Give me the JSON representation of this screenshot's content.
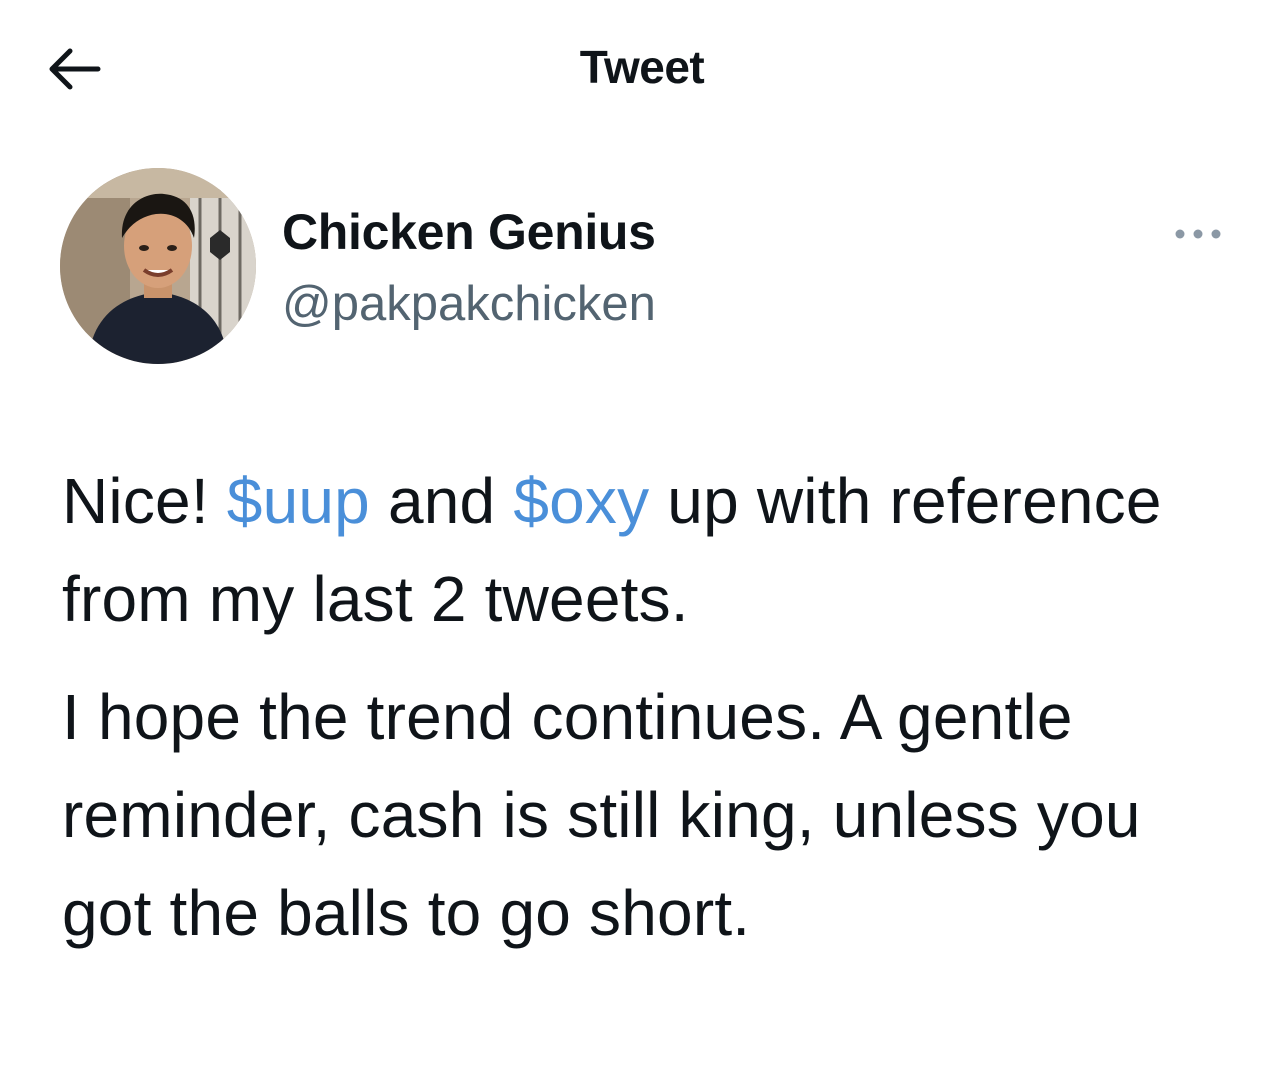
{
  "header": {
    "title": "Tweet",
    "back_icon": "arrow-left-icon"
  },
  "author": {
    "display_name": "Chicken Genius",
    "handle": "@pakpakchicken",
    "more_icon": "more-horizontal-icon"
  },
  "tweet": {
    "paragraph1": {
      "t1": "Nice! ",
      "cashtag1": "$uup",
      "t2": " and ",
      "cashtag2": "$oxy",
      "t3": " up with reference from my last 2 tweets."
    },
    "paragraph2": "I hope the trend continues. A gentle reminder, cash is still king, unless you got the balls to go short."
  },
  "colors": {
    "text": "#0f1419",
    "secondary": "#536471",
    "link": "#4a8fd9",
    "background": "#ffffff"
  }
}
